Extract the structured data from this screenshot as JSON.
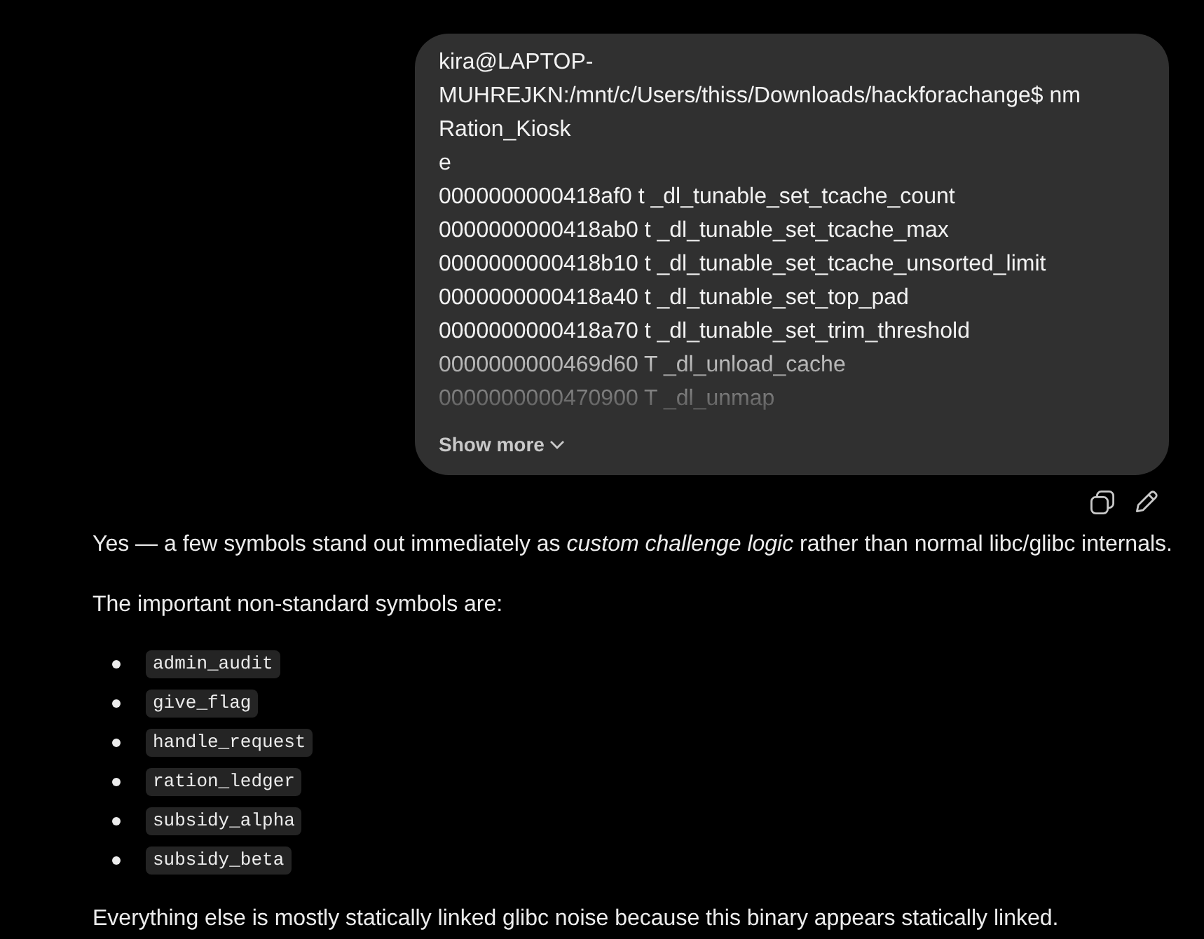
{
  "user_message": {
    "lines": [
      "kira@LAPTOP-",
      "MUHREJKN:/mnt/c/Users/thiss/Downloads/hackforachange$ nm",
      "Ration_Kiosk",
      "e",
      "0000000000418af0 t _dl_tunable_set_tcache_count",
      "0000000000418ab0 t _dl_tunable_set_tcache_max",
      "0000000000418b10 t _dl_tunable_set_tcache_unsorted_limit",
      "0000000000418a40 t _dl_tunable_set_top_pad",
      "0000000000418a70 t _dl_tunable_set_trim_threshold",
      "0000000000469d60 T _dl_unload_cache",
      "0000000000470900 T _dl_unmap"
    ],
    "expanded": false,
    "show_more": "Show more"
  },
  "assistant_message": {
    "blocks": [
      {
        "kind": "paragraph",
        "text": "Yes — a few symbols stand out immediately as *custom challenge logic* rather than normal libc/glibc internals."
      },
      {
        "kind": "paragraph",
        "text": "The important non-standard symbols are:"
      },
      {
        "kind": "code_list",
        "items": [
          "admin_audit",
          "give_flag",
          "handle_request",
          "ration_ledger",
          "subsidy_alpha",
          "subsidy_beta"
        ]
      },
      {
        "kind": "paragraph",
        "text": "Everything else is mostly statically linked glibc noise because this binary appears statically linked."
      }
    ]
  }
}
